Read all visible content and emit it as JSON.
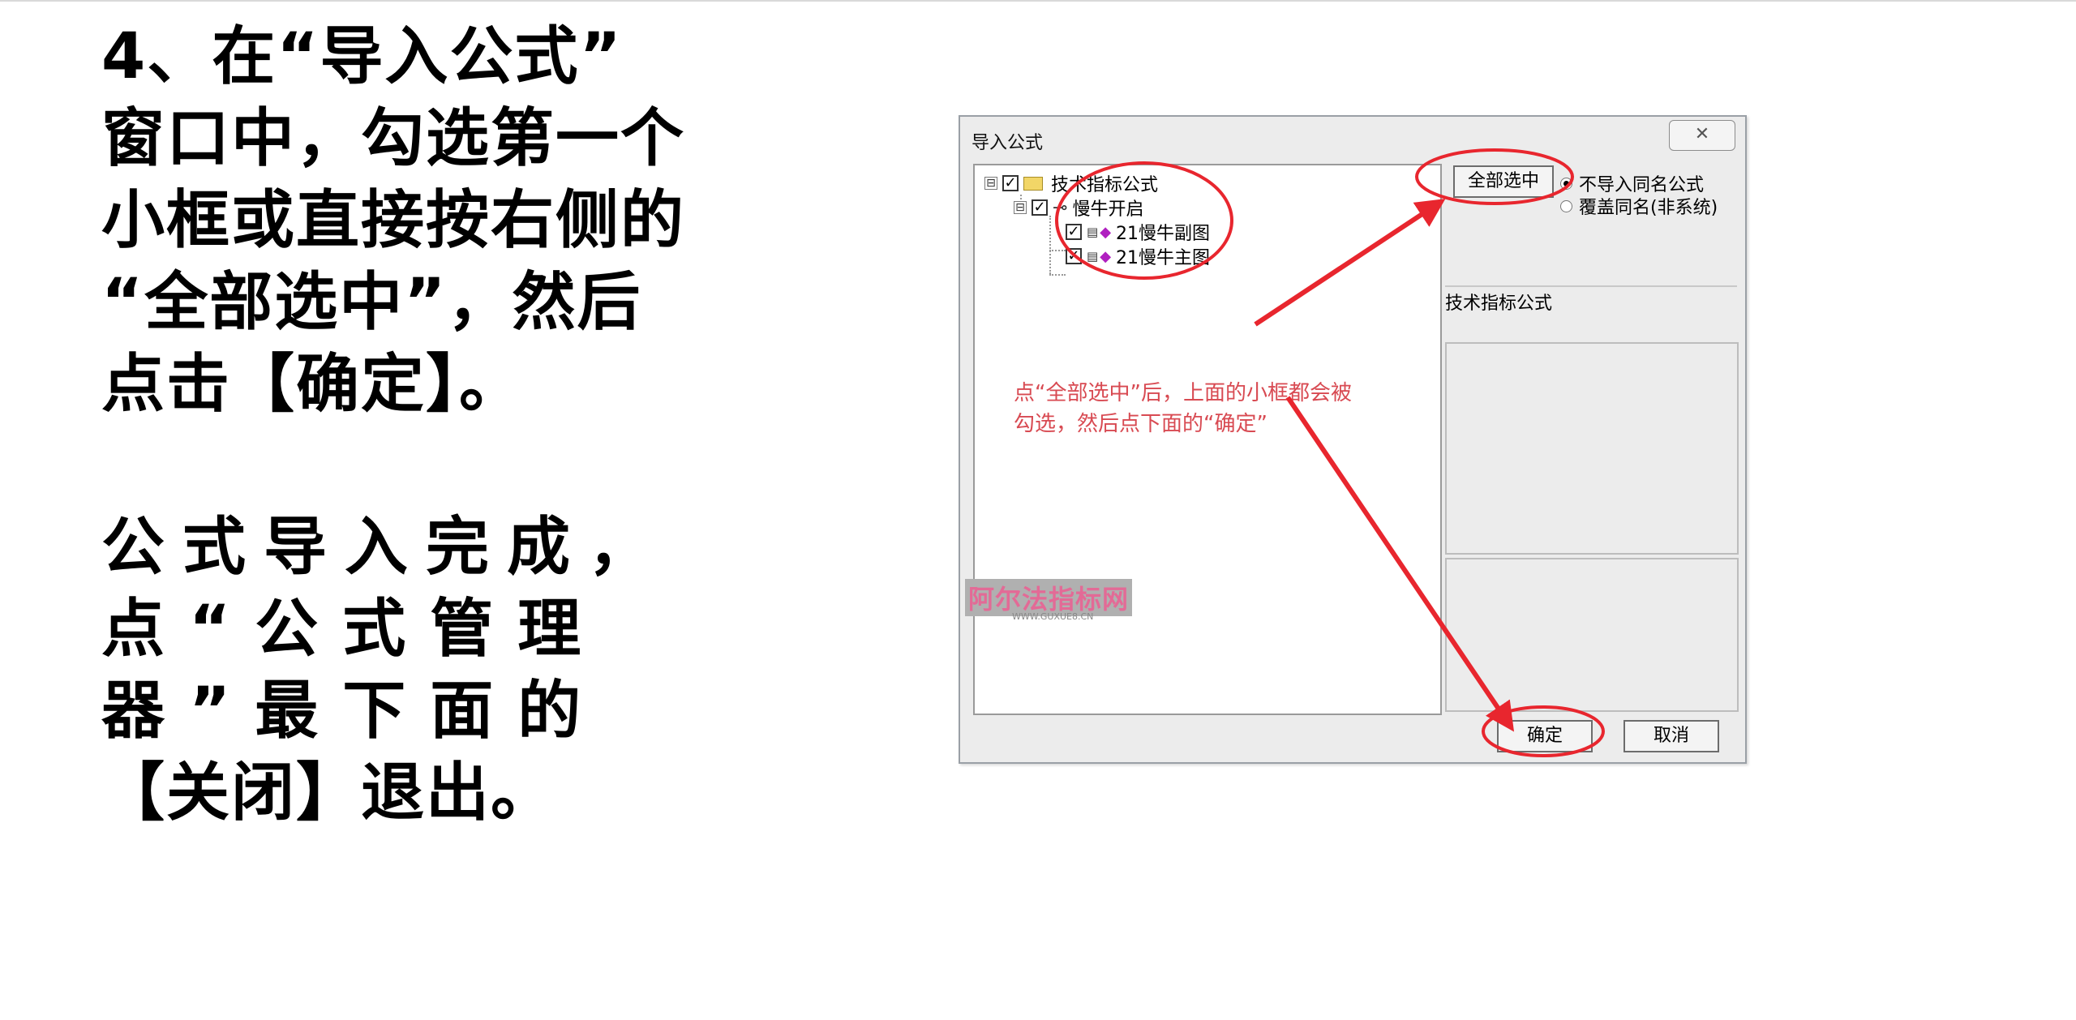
{
  "instructions": {
    "paragraph1": [
      "4、在“导入公式”",
      "窗口中，勾选第一个",
      "小框或直接按右侧的",
      "“全部选中”，然后",
      "点击【确定】。"
    ],
    "paragraph2": [
      "公式导入完成，",
      "点“公式管理",
      "器”最下面的",
      "【关闭】退出。"
    ]
  },
  "dialog": {
    "title": "导入公式",
    "close_symbol": "✕",
    "tree": {
      "root": {
        "label": "技术指标公式",
        "checked": true
      },
      "group": {
        "label": "慢牛开启",
        "checked": true
      },
      "items": [
        {
          "label": "21慢牛副图",
          "checked": true
        },
        {
          "label": "21慢牛主图",
          "checked": true
        }
      ]
    },
    "select_all_label": "全部选中",
    "radio_options": [
      {
        "label": "不导入同名公式",
        "selected": true
      },
      {
        "label": "覆盖同名(非系统)",
        "selected": false
      }
    ],
    "right_panel_label": "技术指标公式",
    "ok_label": "确定",
    "cancel_label": "取消",
    "annotation": [
      "点“全部选中”后，上面的小框都会被",
      "勾选，然后点下面的“确定”"
    ],
    "watermark": "阿尔法指标网",
    "watermark_sub": "WWW.GUXUE8.CN"
  },
  "colors": {
    "annotation": "#e8262e",
    "note_text": "#d84a52"
  },
  "icons": {
    "plus_minus": "⊟",
    "check": "✓",
    "key": "⊸",
    "gem": "◆",
    "doc": "▤"
  }
}
